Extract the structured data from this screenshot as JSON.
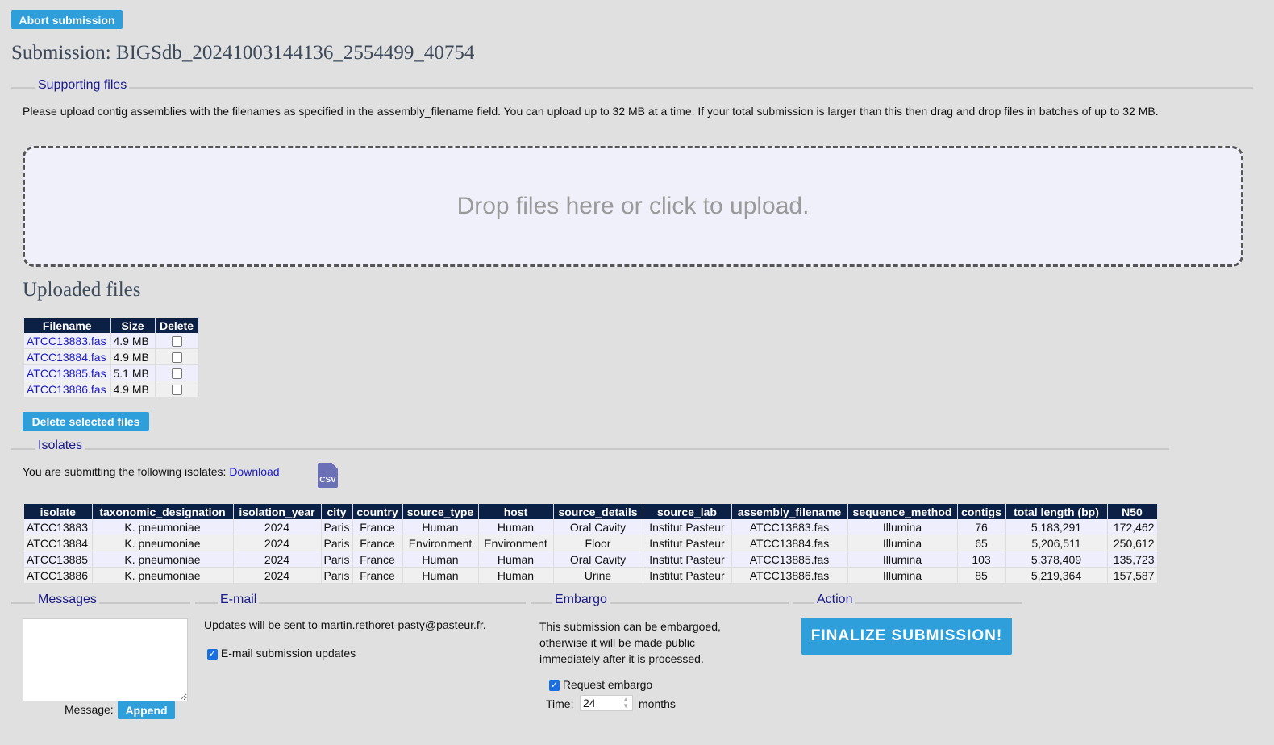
{
  "abort_label": "Abort submission",
  "title": "Submission: BIGSdb_20241003144136_2554499_40754",
  "supporting": {
    "legend": "Supporting files",
    "instructions": "Please upload contig assemblies with the filenames as specified in the assembly_filename field. You can upload up to 32 MB at a time. If your total submission is larger than this then drag and drop files in batches of up to 32 MB.",
    "dropzone": "Drop files here or click to upload."
  },
  "uploaded": {
    "heading": "Uploaded files",
    "headers": [
      "Filename",
      "Size",
      "Delete"
    ],
    "rows": [
      {
        "filename": "ATCC13883.fas",
        "size": "4.9 MB",
        "checked": false
      },
      {
        "filename": "ATCC13884.fas",
        "size": "4.9 MB",
        "checked": false
      },
      {
        "filename": "ATCC13885.fas",
        "size": "5.1 MB",
        "checked": false
      },
      {
        "filename": "ATCC13886.fas",
        "size": "4.9 MB",
        "checked": false
      }
    ],
    "delete_label": "Delete selected files"
  },
  "isolates": {
    "legend": "Isolates",
    "intro": "You are submitting the following isolates:",
    "download_label": "Download",
    "csv_icon_label": "CSV",
    "headers": [
      "isolate",
      "taxonomic_designation",
      "isolation_year",
      "city",
      "country",
      "source_type",
      "host",
      "source_details",
      "source_lab",
      "assembly_filename",
      "sequence_method",
      "contigs",
      "total length (bp)",
      "N50"
    ],
    "rows": [
      [
        "ATCC13883",
        "K. pneumoniae",
        "2024",
        "Paris",
        "France",
        "Human",
        "Human",
        "Oral Cavity",
        "Institut Pasteur",
        "ATCC13883.fas",
        "Illumina",
        "76",
        "5,183,291",
        "172,462"
      ],
      [
        "ATCC13884",
        "K. pneumoniae",
        "2024",
        "Paris",
        "France",
        "Environment",
        "Environment",
        "Floor",
        "Institut Pasteur",
        "ATCC13884.fas",
        "Illumina",
        "65",
        "5,206,511",
        "250,612"
      ],
      [
        "ATCC13885",
        "K. pneumoniae",
        "2024",
        "Paris",
        "France",
        "Human",
        "Human",
        "Oral Cavity",
        "Institut Pasteur",
        "ATCC13885.fas",
        "Illumina",
        "103",
        "5,378,409",
        "135,723"
      ],
      [
        "ATCC13886",
        "K. pneumoniae",
        "2024",
        "Paris",
        "France",
        "Human",
        "Human",
        "Urine",
        "Institut Pasteur",
        "ATCC13886.fas",
        "Illumina",
        "85",
        "5,219,364",
        "157,587"
      ]
    ]
  },
  "messages": {
    "legend": "Messages",
    "message_label": "Message:",
    "append_label": "Append",
    "value": ""
  },
  "email": {
    "legend": "E-mail",
    "info": "Updates will be sent to martin.rethoret-pasty@pasteur.fr.",
    "checkbox_label": "E-mail submission updates",
    "checked": true
  },
  "embargo": {
    "legend": "Embargo",
    "info": "This submission can be embargoed, otherwise it will be made public immediately after it is processed.",
    "checkbox_label": "Request embargo",
    "checked": true,
    "time_label": "Time:",
    "time_value": "24",
    "unit": "months"
  },
  "action": {
    "legend": "Action",
    "finalize_label": "FINALIZE SUBMISSION!"
  }
}
